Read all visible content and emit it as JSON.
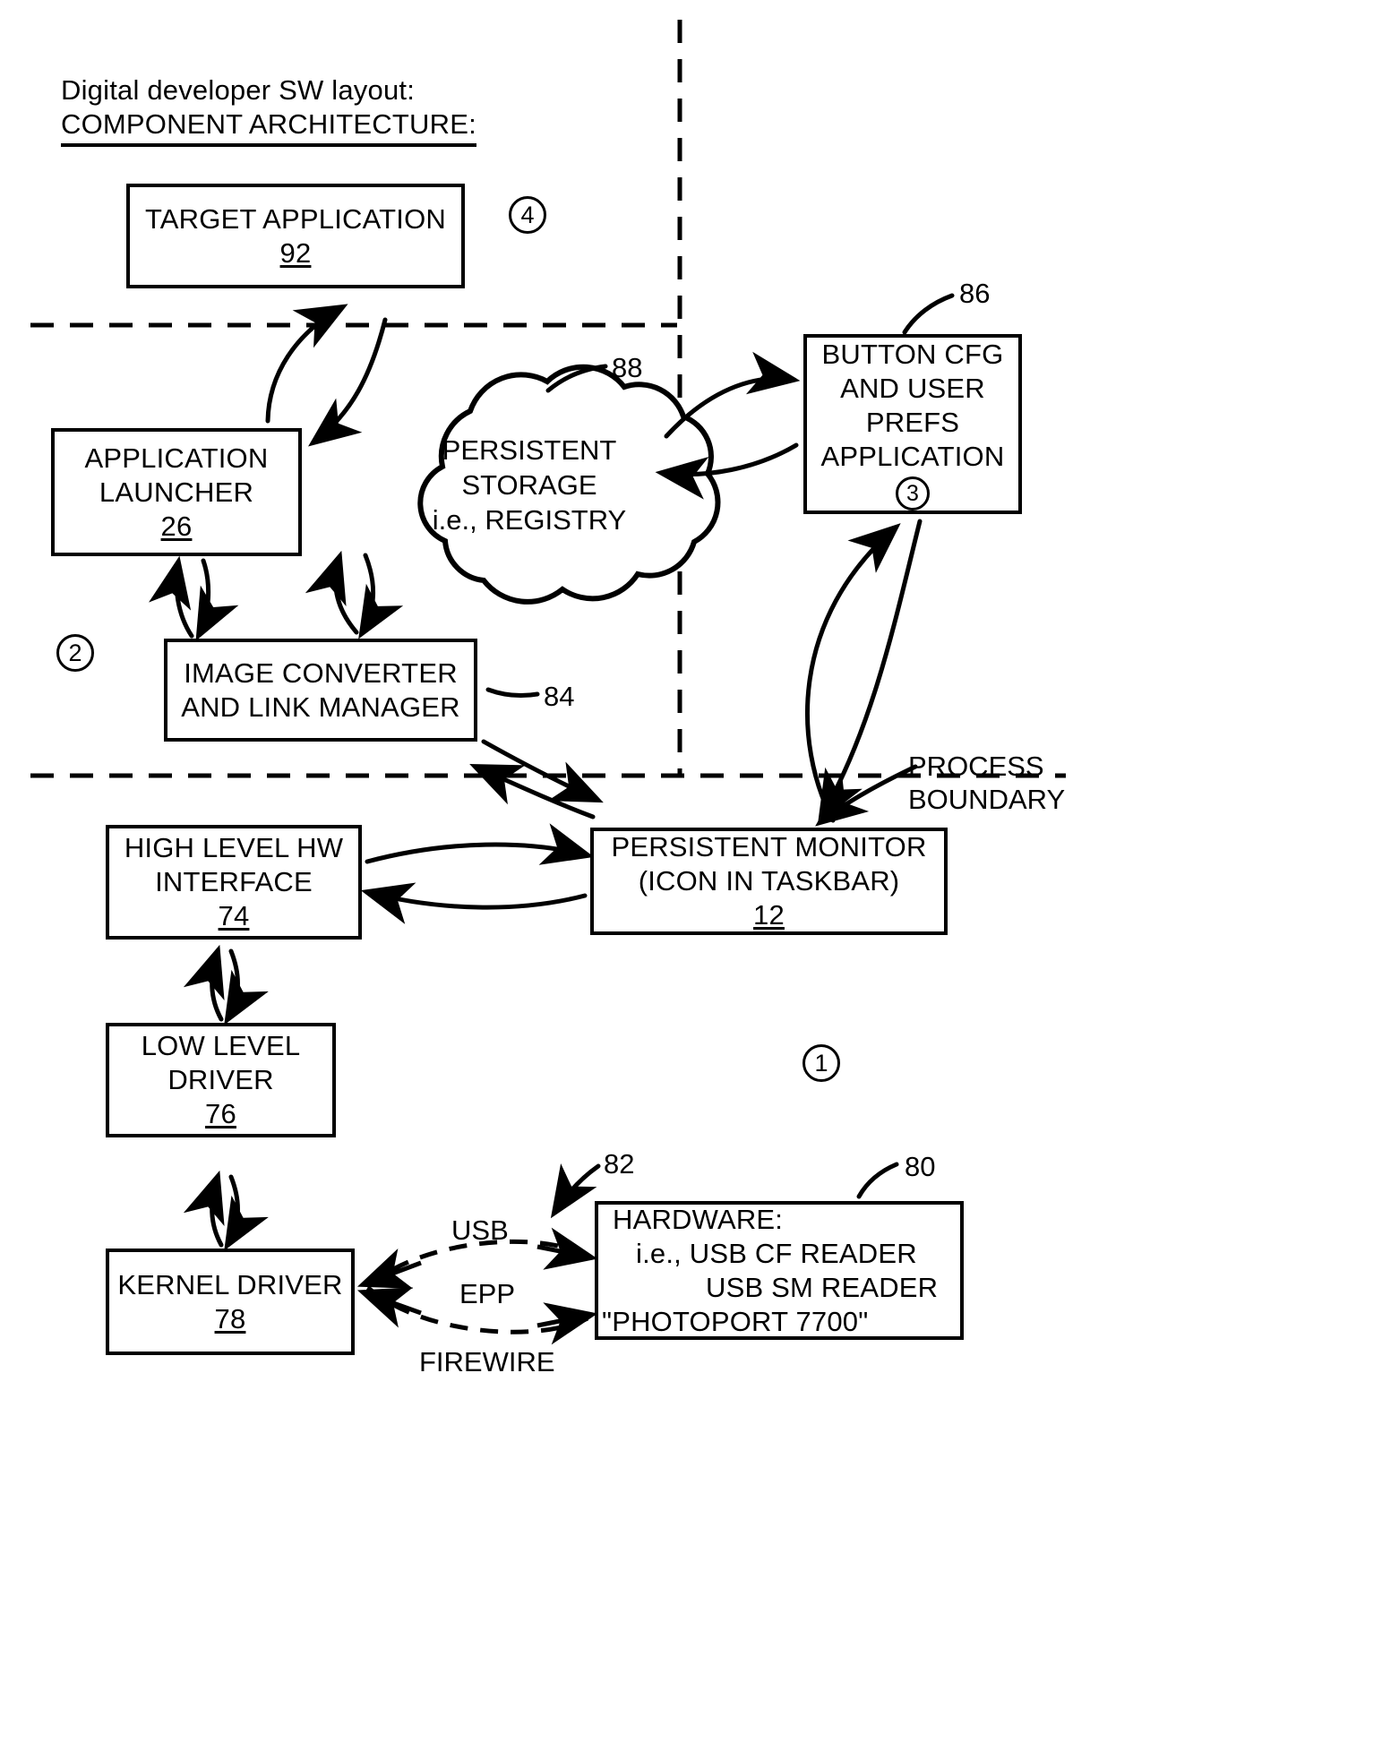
{
  "figure": {
    "title_line1": "Digital developer SW layout:",
    "title_line2": "COMPONENT ARCHITECTURE:",
    "type": "component-architecture-block-diagram"
  },
  "nodes": {
    "target_application": {
      "line1": "TARGET APPLICATION",
      "ref": "92"
    },
    "application_launcher": {
      "line1": "APPLICATION",
      "line2": "LAUNCHER",
      "ref": "26"
    },
    "image_converter": {
      "line1": "IMAGE CONVERTER",
      "line2": "AND LINK MANAGER"
    },
    "persistent_storage": {
      "line1": "PERSISTENT",
      "line2": "STORAGE",
      "line3": "i.e., REGISTRY"
    },
    "button_cfg": {
      "line1": "BUTTON CFG",
      "line2": "AND USER",
      "line3": "PREFS",
      "line4": "APPLICATION",
      "step": "3"
    },
    "persistent_monitor": {
      "line1": "PERSISTENT MONITOR",
      "line2": "(ICON IN TASKBAR)",
      "ref": "12"
    },
    "high_level_hw": {
      "line1": "HIGH LEVEL HW",
      "line2": "INTERFACE",
      "ref": "74"
    },
    "low_level_driver": {
      "line1": "LOW LEVEL",
      "line2": "DRIVER",
      "ref": "76"
    },
    "kernel_driver": {
      "line1": "KERNEL DRIVER",
      "ref": "78"
    },
    "hardware": {
      "line1": "HARDWARE:",
      "line2": "i.e.,  USB CF READER",
      "line3": "USB SM READER",
      "line4": "\"PHOTOPORT 7700\""
    }
  },
  "reference_numerals": {
    "storage": "88",
    "button_cfg": "86",
    "image_converter": "84",
    "bus": "82",
    "hardware": "80"
  },
  "bus_labels": {
    "top": "USB",
    "middle": "EPP",
    "bottom": "FIREWIRE"
  },
  "boundary": {
    "line1": "PROCESS",
    "line2": "BOUNDARY"
  },
  "step_markers": {
    "one": "1",
    "two": "2",
    "three": "3",
    "four": "4"
  },
  "colors": {
    "ink": "#000000",
    "paper": "#ffffff"
  }
}
